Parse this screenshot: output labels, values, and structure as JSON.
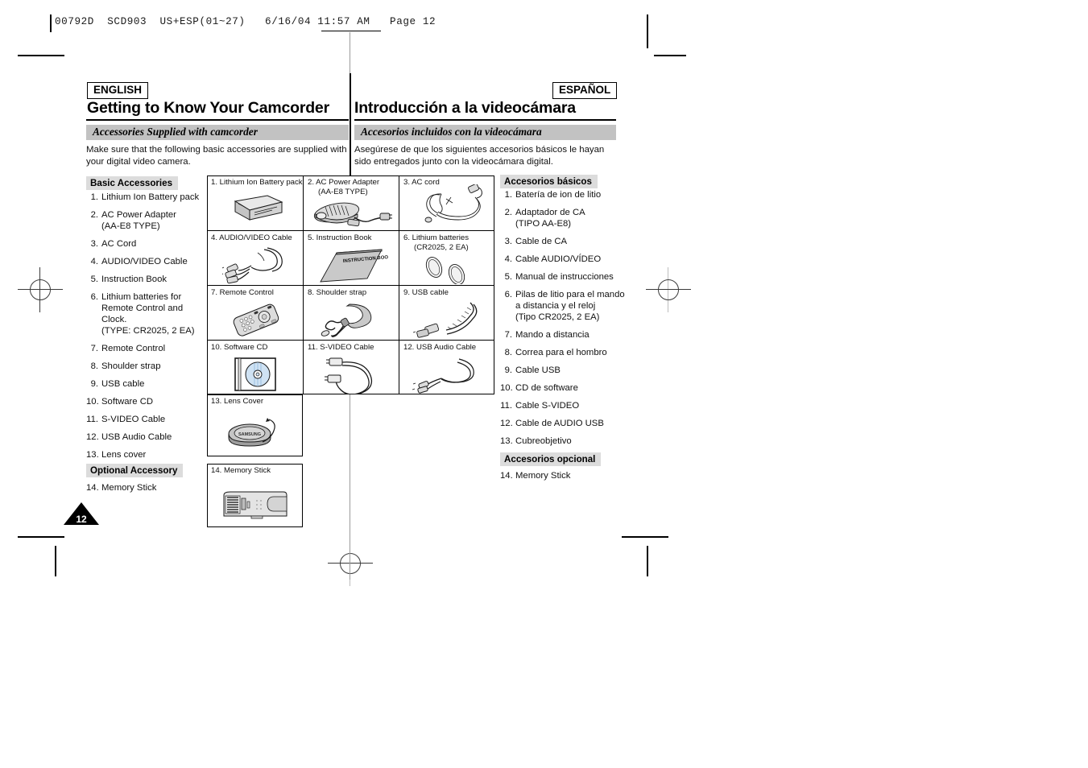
{
  "slug": "00792D  SCD903  US+ESP(01~27)   6/16/04 11:57 AM   Page 12",
  "page_number": "12",
  "english": {
    "lang_tag": "ENGLISH",
    "chapter_title": "Getting to Know Your Camcorder",
    "section_band": "Accessories Supplied with camcorder",
    "intro": "Make sure that the following basic accessories are supplied with your digital video camera.",
    "basic_head": "Basic Accessories",
    "basic_items": [
      {
        "num": "1.",
        "label": "Lithium Ion Battery pack",
        "sub": ""
      },
      {
        "num": "2.",
        "label": "AC Power Adapter",
        "sub": "(AA-E8 TYPE)"
      },
      {
        "num": "3.",
        "label": "AC Cord",
        "sub": ""
      },
      {
        "num": "4.",
        "label": "AUDIO/VIDEO Cable",
        "sub": ""
      },
      {
        "num": "5.",
        "label": "Instruction Book",
        "sub": ""
      },
      {
        "num": "6.",
        "label": "Lithium batteries for",
        "sub": "Remote Control and Clock.\n(TYPE: CR2025, 2 EA)"
      },
      {
        "num": "7.",
        "label": "Remote Control",
        "sub": ""
      },
      {
        "num": "8.",
        "label": "Shoulder strap",
        "sub": ""
      },
      {
        "num": "9.",
        "label": "USB cable",
        "sub": ""
      },
      {
        "num": "10.",
        "label": "Software CD",
        "sub": ""
      },
      {
        "num": "11.",
        "label": "S-VIDEO Cable",
        "sub": ""
      },
      {
        "num": "12.",
        "label": "USB Audio Cable",
        "sub": ""
      },
      {
        "num": "13.",
        "label": "Lens cover",
        "sub": ""
      }
    ],
    "optional_head": "Optional Accessory",
    "optional_items": [
      {
        "num": "14.",
        "label": "Memory Stick",
        "sub": ""
      }
    ]
  },
  "spanish": {
    "lang_tag": "ESPAÑOL",
    "chapter_title": "Introducción a la videocámara",
    "section_band": "Accesorios incluidos con la videocámara",
    "intro": "Asegúrese de que los siguientes accesorios básicos le hayan sido entregados junto con la videocámara digital.",
    "basic_head": "Accesorios básicos",
    "basic_items": [
      {
        "num": "1.",
        "label": "Batería de ion de litio",
        "sub": ""
      },
      {
        "num": "2.",
        "label": "Adaptador de CA",
        "sub": "(TIPO AA-E8)"
      },
      {
        "num": "3.",
        "label": "Cable de CA",
        "sub": ""
      },
      {
        "num": "4.",
        "label": "Cable AUDIO/VÍDEO",
        "sub": ""
      },
      {
        "num": "5.",
        "label": "Manual de instrucciones",
        "sub": ""
      },
      {
        "num": "6.",
        "label": "Pilas de litio para el mando",
        "sub": "a distancia y el reloj\n(Tipo CR2025, 2 EA)"
      },
      {
        "num": "7.",
        "label": "Mando a distancia",
        "sub": ""
      },
      {
        "num": "8.",
        "label": "Correa para el hombro",
        "sub": ""
      },
      {
        "num": "9.",
        "label": "Cable USB",
        "sub": ""
      },
      {
        "num": "10.",
        "label": "CD de software",
        "sub": ""
      },
      {
        "num": "11.",
        "label": "Cable S-VIDEO",
        "sub": ""
      },
      {
        "num": "12.",
        "label": "Cable de AUDIO USB",
        "sub": ""
      },
      {
        "num": "13.",
        "label": "Cubreobjetivo",
        "sub": ""
      }
    ],
    "optional_head": "Accesorios opcional",
    "optional_items": [
      {
        "num": "14.",
        "label": "Memory Stick",
        "sub": ""
      }
    ]
  },
  "grid": {
    "cells": [
      {
        "caption_line1": "1. Lithium Ion Battery pack",
        "caption_line2": "",
        "icon": "battery-pack-icon"
      },
      {
        "caption_line1": "2. AC Power Adapter",
        "caption_line2": "(AA-E8 TYPE)",
        "icon": "ac-power-adapter-icon"
      },
      {
        "caption_line1": "3. AC cord",
        "caption_line2": "",
        "icon": "ac-cord-icon"
      },
      {
        "caption_line1": "4. AUDIO/VIDEO Cable",
        "caption_line2": "",
        "icon": "av-cable-icon"
      },
      {
        "caption_line1": "5. Instruction Book",
        "caption_line2": "",
        "icon": "instruction-book-icon"
      },
      {
        "caption_line1": "6. Lithium batteries",
        "caption_line2": "(CR2025, 2 EA)",
        "icon": "coin-batteries-icon"
      },
      {
        "caption_line1": "7. Remote Control",
        "caption_line2": "",
        "icon": "remote-control-icon"
      },
      {
        "caption_line1": "8. Shoulder strap",
        "caption_line2": "",
        "icon": "shoulder-strap-icon"
      },
      {
        "caption_line1": "9. USB cable",
        "caption_line2": "",
        "icon": "usb-cable-icon"
      },
      {
        "caption_line1": "10. Software CD",
        "caption_line2": "",
        "icon": "software-cd-icon"
      },
      {
        "caption_line1": "11. S-VIDEO Cable",
        "caption_line2": "",
        "icon": "svideo-cable-icon"
      },
      {
        "caption_line1": "12. USB Audio Cable",
        "caption_line2": "",
        "icon": "usb-audio-cable-icon"
      },
      {
        "caption_line1": "13. Lens Cover",
        "caption_line2": "",
        "icon": "lens-cover-icon"
      },
      {
        "caption_line1": "14. Memory Stick",
        "caption_line2": "",
        "icon": "memory-stick-icon"
      }
    ],
    "book_cover_text": "INSTRUCTION BOOK"
  },
  "colors": {
    "band_gray": "#c2c2c2",
    "subhead_gray": "#dcdcdc",
    "ink": "#000000",
    "cd_blue": "#cfe2f3"
  }
}
